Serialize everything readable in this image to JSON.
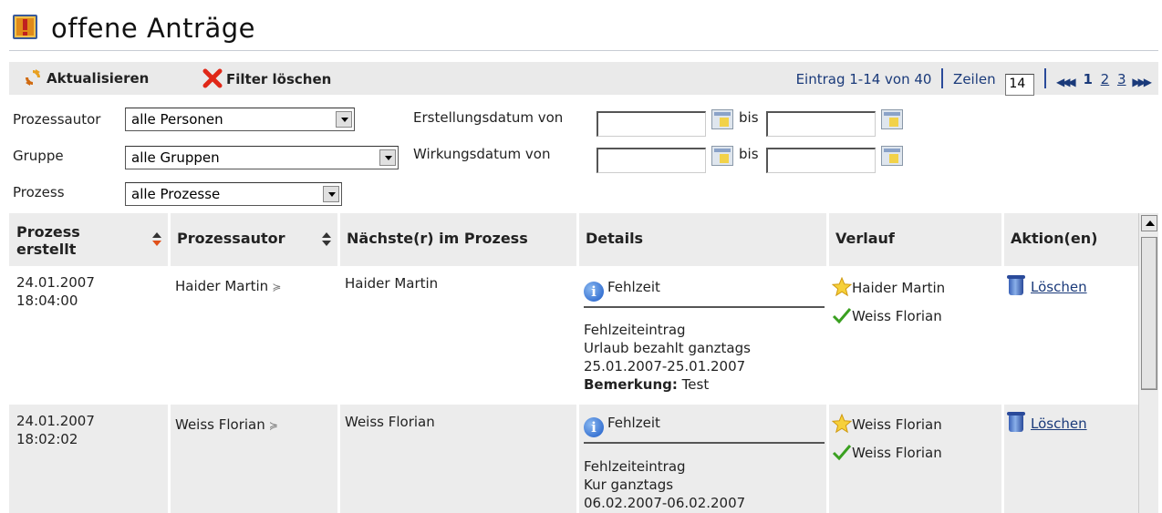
{
  "page": {
    "title": "offene Anträge"
  },
  "toolbar": {
    "refresh_label": "Aktualisieren",
    "clear_filter_label": "Filter löschen",
    "entries_text": "Eintrag 1-14 von 40",
    "rows_label": "Zeilen",
    "rows_value": "14",
    "pages": [
      "1",
      "2",
      "3"
    ],
    "current_page": "1"
  },
  "filters": {
    "author_label": "Prozessautor",
    "author_value": "alle Personen",
    "group_label": "Gruppe",
    "group_value": "alle Gruppen",
    "process_label": "Prozess",
    "process_value": "alle Prozesse",
    "created_from_label": "Erstellungsdatum von",
    "effective_from_label": "Wirkungsdatum von",
    "to_label": "bis"
  },
  "table": {
    "columns": [
      "Prozess erstellt",
      "Prozessautor",
      "Nächste(r) im Prozess",
      "Details",
      "Verlauf",
      "Aktion(en)"
    ],
    "rows": [
      {
        "created_date": "24.01.2007",
        "created_time": "18:04:00",
        "author": "Haider Martin",
        "next": "Haider Martin",
        "details_type": "Fehlzeit",
        "details_lines": [
          "Fehlzeiteintrag",
          "Urlaub bezahlt ganztags",
          "25.01.2007-25.01.2007"
        ],
        "remark_label": "Bemerkung:",
        "remark_value": " Test",
        "history": [
          "Haider Martin",
          "Weiss Florian"
        ],
        "action": "Löschen"
      },
      {
        "created_date": "24.01.2007",
        "created_time": "18:02:02",
        "author": "Weiss Florian",
        "next": "Weiss Florian",
        "details_type": "Fehlzeit",
        "details_lines": [
          "Fehlzeiteintrag",
          "Kur ganztags",
          "06.02.2007-06.02.2007"
        ],
        "history": [
          "Weiss Florian",
          "Weiss Florian"
        ],
        "action": "Löschen"
      }
    ]
  },
  "colors": {
    "header_bg": "#ececec",
    "link": "#1a3a7a",
    "sort_active": "#e0501a"
  }
}
